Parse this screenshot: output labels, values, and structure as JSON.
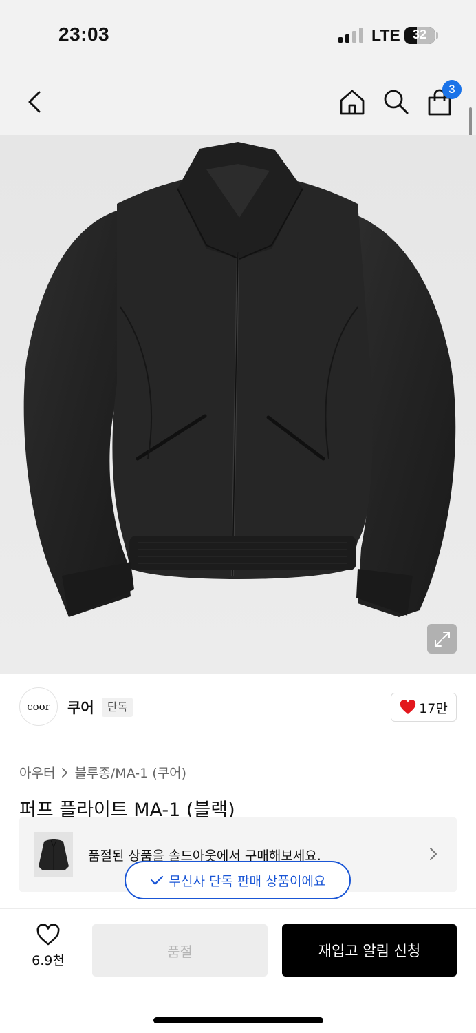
{
  "status_bar": {
    "time": "23:03",
    "network": "LTE",
    "battery": "32",
    "signal_bars": 2
  },
  "nav": {
    "back_icon": "chevron-left-icon",
    "home_icon": "home-icon",
    "search_icon": "search-icon",
    "cart_icon": "shopping-bag-icon",
    "cart_badge": "3",
    "badge_color": "#1a73e8"
  },
  "brand": {
    "logo_text": "coor",
    "name": "쿠어",
    "tag": "단독",
    "like_count": "17만",
    "like_color": "#e3171d"
  },
  "breadcrumb": {
    "category": "아우터",
    "subcategory": "블루종/MA-1 (쿠어)"
  },
  "product": {
    "title": "퍼프 플라이트 MA-1 (블랙)"
  },
  "soldout_banner": {
    "text": "품절된 상품을 솔드아웃에서 구매해보세요."
  },
  "exclusive_badge": {
    "text": "무신사 단독 판매 상품이에요",
    "color": "#1a56d6"
  },
  "bottom_bar": {
    "wish_count": "6.9천",
    "soldout_label": "품절",
    "restock_label": "재입고 알림 신청"
  }
}
